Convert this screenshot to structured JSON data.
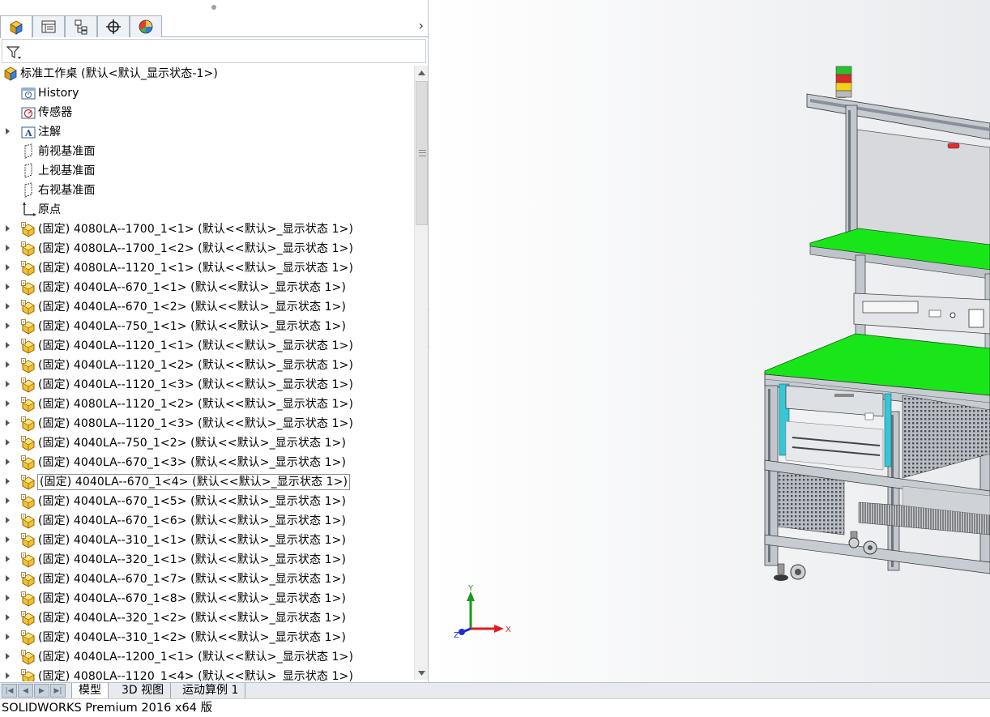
{
  "tabs": [
    {
      "icon": "feature-manager-icon"
    },
    {
      "icon": "property-manager-icon"
    },
    {
      "icon": "configuration-manager-icon"
    },
    {
      "icon": "dimxpert-icon"
    },
    {
      "icon": "display-manager-icon"
    }
  ],
  "tree": [
    {
      "label": "标准工作桌  (默认<默认_显示状态-1>)",
      "icon": "assembly-icon",
      "expander": false,
      "level": 0
    },
    {
      "label": "History",
      "icon": "history-icon",
      "expander": false,
      "level": 1
    },
    {
      "label": "传感器",
      "icon": "sensor-icon",
      "expander": false,
      "level": 1
    },
    {
      "label": "注解",
      "icon": "annotation-icon",
      "expander": true,
      "level": 1
    },
    {
      "label": "前视基准面",
      "icon": "plane-icon",
      "expander": false,
      "level": 1
    },
    {
      "label": "上视基准面",
      "icon": "plane-icon",
      "expander": false,
      "level": 1
    },
    {
      "label": "右视基准面",
      "icon": "plane-icon",
      "expander": false,
      "level": 1
    },
    {
      "label": "原点",
      "icon": "origin-icon",
      "expander": false,
      "level": 1
    },
    {
      "label": "(固定) 4080LA--1700_1<1> (默认<<默认>_显示状态 1>)",
      "icon": "part-icon",
      "expander": true,
      "level": 1
    },
    {
      "label": "(固定) 4080LA--1700_1<2> (默认<<默认>_显示状态 1>)",
      "icon": "part-icon",
      "expander": true,
      "level": 1
    },
    {
      "label": "(固定) 4080LA--1120_1<1> (默认<<默认>_显示状态 1>)",
      "icon": "part-icon",
      "expander": true,
      "level": 1
    },
    {
      "label": "(固定) 4040LA--670_1<1> (默认<<默认>_显示状态 1>)",
      "icon": "part-icon",
      "expander": true,
      "level": 1
    },
    {
      "label": "(固定) 4040LA--670_1<2> (默认<<默认>_显示状态 1>)",
      "icon": "part-icon",
      "expander": true,
      "level": 1
    },
    {
      "label": "(固定) 4040LA--750_1<1> (默认<<默认>_显示状态 1>)",
      "icon": "part-icon",
      "expander": true,
      "level": 1
    },
    {
      "label": "(固定) 4040LA--1120_1<1> (默认<<默认>_显示状态 1>)",
      "icon": "part-icon",
      "expander": true,
      "level": 1
    },
    {
      "label": "(固定) 4040LA--1120_1<2> (默认<<默认>_显示状态 1>)",
      "icon": "part-icon",
      "expander": true,
      "level": 1
    },
    {
      "label": "(固定) 4040LA--1120_1<3> (默认<<默认>_显示状态 1>)",
      "icon": "part-icon",
      "expander": true,
      "level": 1
    },
    {
      "label": "(固定) 4080LA--1120_1<2> (默认<<默认>_显示状态 1>)",
      "icon": "part-icon",
      "expander": true,
      "level": 1
    },
    {
      "label": "(固定) 4080LA--1120_1<3> (默认<<默认>_显示状态 1>)",
      "icon": "part-icon",
      "expander": true,
      "level": 1
    },
    {
      "label": "(固定) 4040LA--750_1<2> (默认<<默认>_显示状态 1>)",
      "icon": "part-icon",
      "expander": true,
      "level": 1
    },
    {
      "label": "(固定) 4040LA--670_1<3> (默认<<默认>_显示状态 1>)",
      "icon": "part-icon",
      "expander": true,
      "level": 1
    },
    {
      "label": "(固定) 4040LA--670_1<4> (默认<<默认>_显示状态 1>)",
      "icon": "part-icon",
      "expander": true,
      "level": 1,
      "selected": true
    },
    {
      "label": "(固定) 4040LA--670_1<5> (默认<<默认>_显示状态 1>)",
      "icon": "part-icon",
      "expander": true,
      "level": 1
    },
    {
      "label": "(固定) 4040LA--670_1<6> (默认<<默认>_显示状态 1>)",
      "icon": "part-icon",
      "expander": true,
      "level": 1
    },
    {
      "label": "(固定) 4040LA--310_1<1> (默认<<默认>_显示状态 1>)",
      "icon": "part-icon",
      "expander": true,
      "level": 1
    },
    {
      "label": "(固定) 4040LA--320_1<1> (默认<<默认>_显示状态 1>)",
      "icon": "part-icon",
      "expander": true,
      "level": 1
    },
    {
      "label": "(固定) 4040LA--670_1<7> (默认<<默认>_显示状态 1>)",
      "icon": "part-icon",
      "expander": true,
      "level": 1
    },
    {
      "label": "(固定) 4040LA--670_1<8> (默认<<默认>_显示状态 1>)",
      "icon": "part-icon",
      "expander": true,
      "level": 1
    },
    {
      "label": "(固定) 4040LA--320_1<2> (默认<<默认>_显示状态 1>)",
      "icon": "part-icon",
      "expander": true,
      "level": 1
    },
    {
      "label": "(固定) 4040LA--310_1<2> (默认<<默认>_显示状态 1>)",
      "icon": "part-icon",
      "expander": true,
      "level": 1
    },
    {
      "label": "(固定) 4040LA--1200_1<1> (默认<<默认>_显示状态 1>)",
      "icon": "part-icon",
      "expander": true,
      "level": 1
    },
    {
      "label": "(固定) 4080LA--1120_1<4> (默认<<默认>_显示状态 1>)",
      "icon": "part-icon",
      "expander": true,
      "level": 1
    }
  ],
  "triad": {
    "x_label": "X",
    "y_label": "Y",
    "z_label": "Z"
  },
  "bottom_tabs": [
    "模型",
    "3D 视图",
    "运动算例 1"
  ],
  "active_bottom_tab": 0,
  "status_text": "SOLIDWORKS Premium 2016 x64 版",
  "colors": {
    "accent_green": "#19e619",
    "frame_grey": "#c7ccd2",
    "part_icon_yellow": "#f2c233",
    "axis_x": "#e01e1e",
    "axis_y": "#1a9a1a",
    "axis_z": "#1c2cd6"
  }
}
